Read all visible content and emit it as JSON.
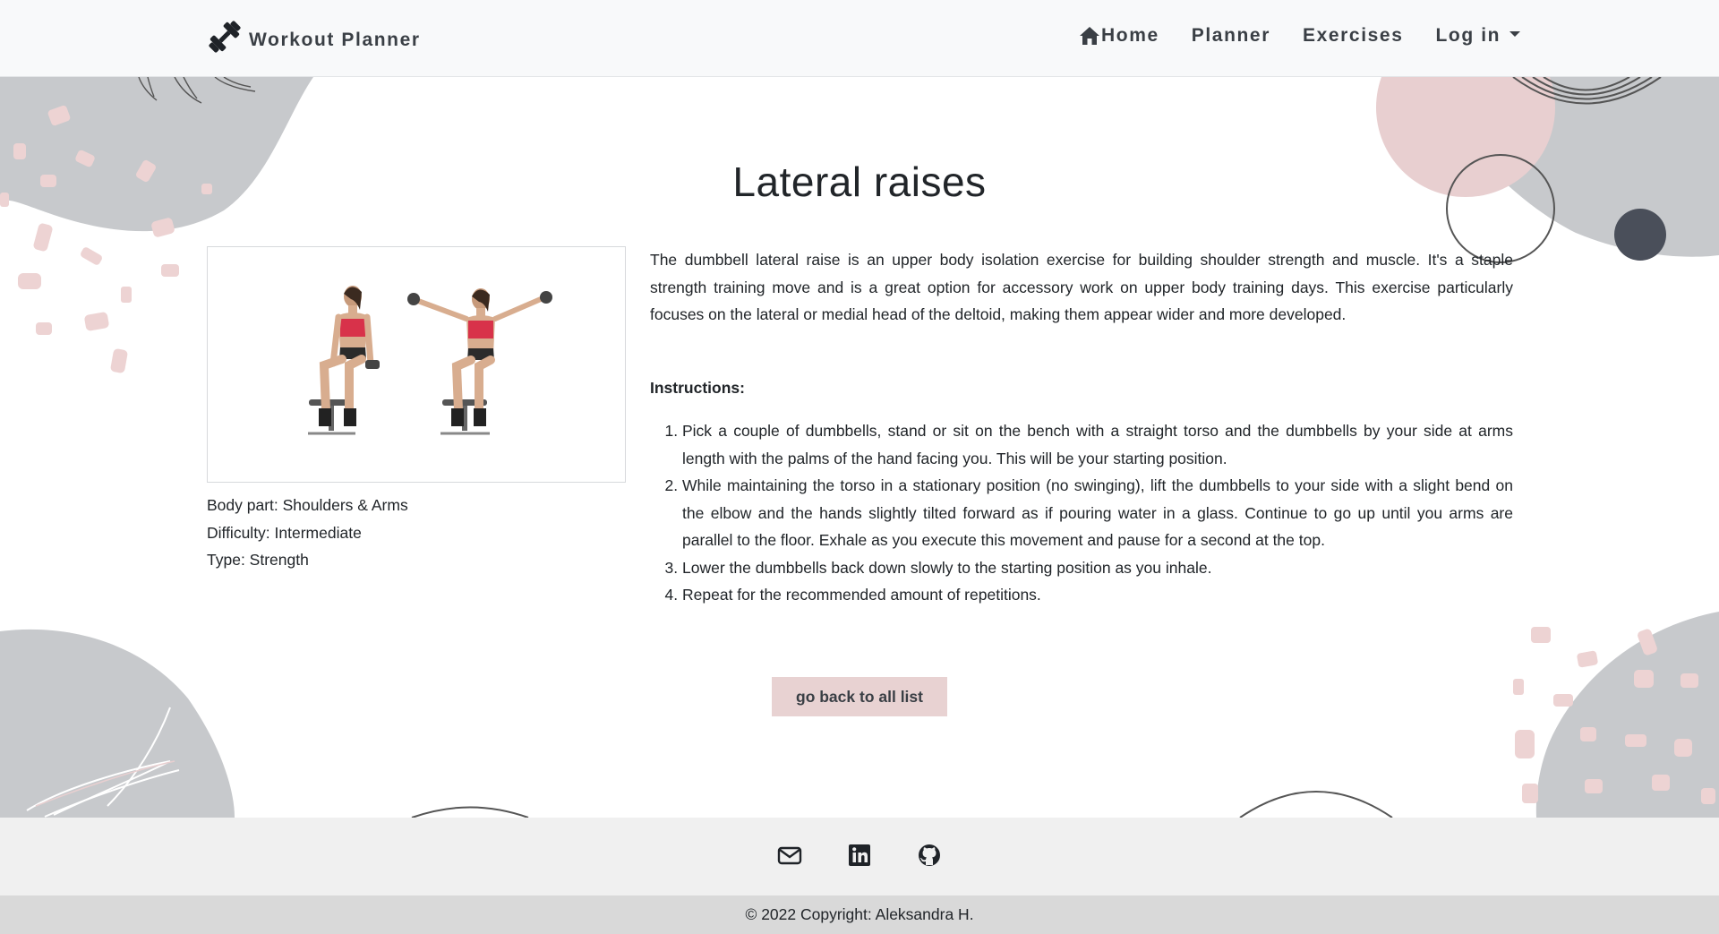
{
  "navbar": {
    "brand": "Workout Planner",
    "links": [
      {
        "label": "Home"
      },
      {
        "label": "Planner"
      },
      {
        "label": "Exercises"
      },
      {
        "label": "Log in"
      }
    ]
  },
  "exercise": {
    "title": "Lateral raises",
    "meta": {
      "body_part": "Body part: Shoulders & Arms",
      "difficulty": "Difficulty: Intermediate",
      "type": "Type: Strength"
    },
    "description": "The dumbbell lateral raise is an upper body isolation exercise for building shoulder strength and muscle. It's a staple strength training move and is a great option for accessory work on upper body training days. This exercise particularly focuses on the lateral or medial head of the deltoid, making them appear wider and more developed.",
    "instructions_heading": "Instructions:",
    "instructions": [
      "Pick a couple of dumbbells, stand or sit on the bench with a straight torso and the dumbbells by your side at arms length with the palms of the hand facing you. This will be your starting position.",
      "While maintaining the torso in a stationary position (no swinging), lift the dumbbells to your side with a slight bend on the elbow and the hands slightly tilted forward as if pouring water in a glass. Continue to go up until you arms are parallel to the floor. Exhale as you execute this movement and pause for a second at the top.",
      "Lower the dumbbells back down slowly to the starting position as you inhale.",
      "Repeat for the recommended amount of repetitions."
    ],
    "back_button": "go back to all list"
  },
  "footer": {
    "icons": [
      "envelope-icon",
      "linkedin-icon",
      "github-icon"
    ],
    "copyright": "© 2022 Copyright: Aleksandra H."
  },
  "colors": {
    "navbar_bg": "#f8f9fa",
    "accent_pink": "#e8d2d2",
    "deco_gray": "#c7c9cc",
    "deco_dark": "#4a4f5a",
    "footer_bg": "#f0f0f0",
    "footer_bottom_bg": "#d9d9d9"
  }
}
